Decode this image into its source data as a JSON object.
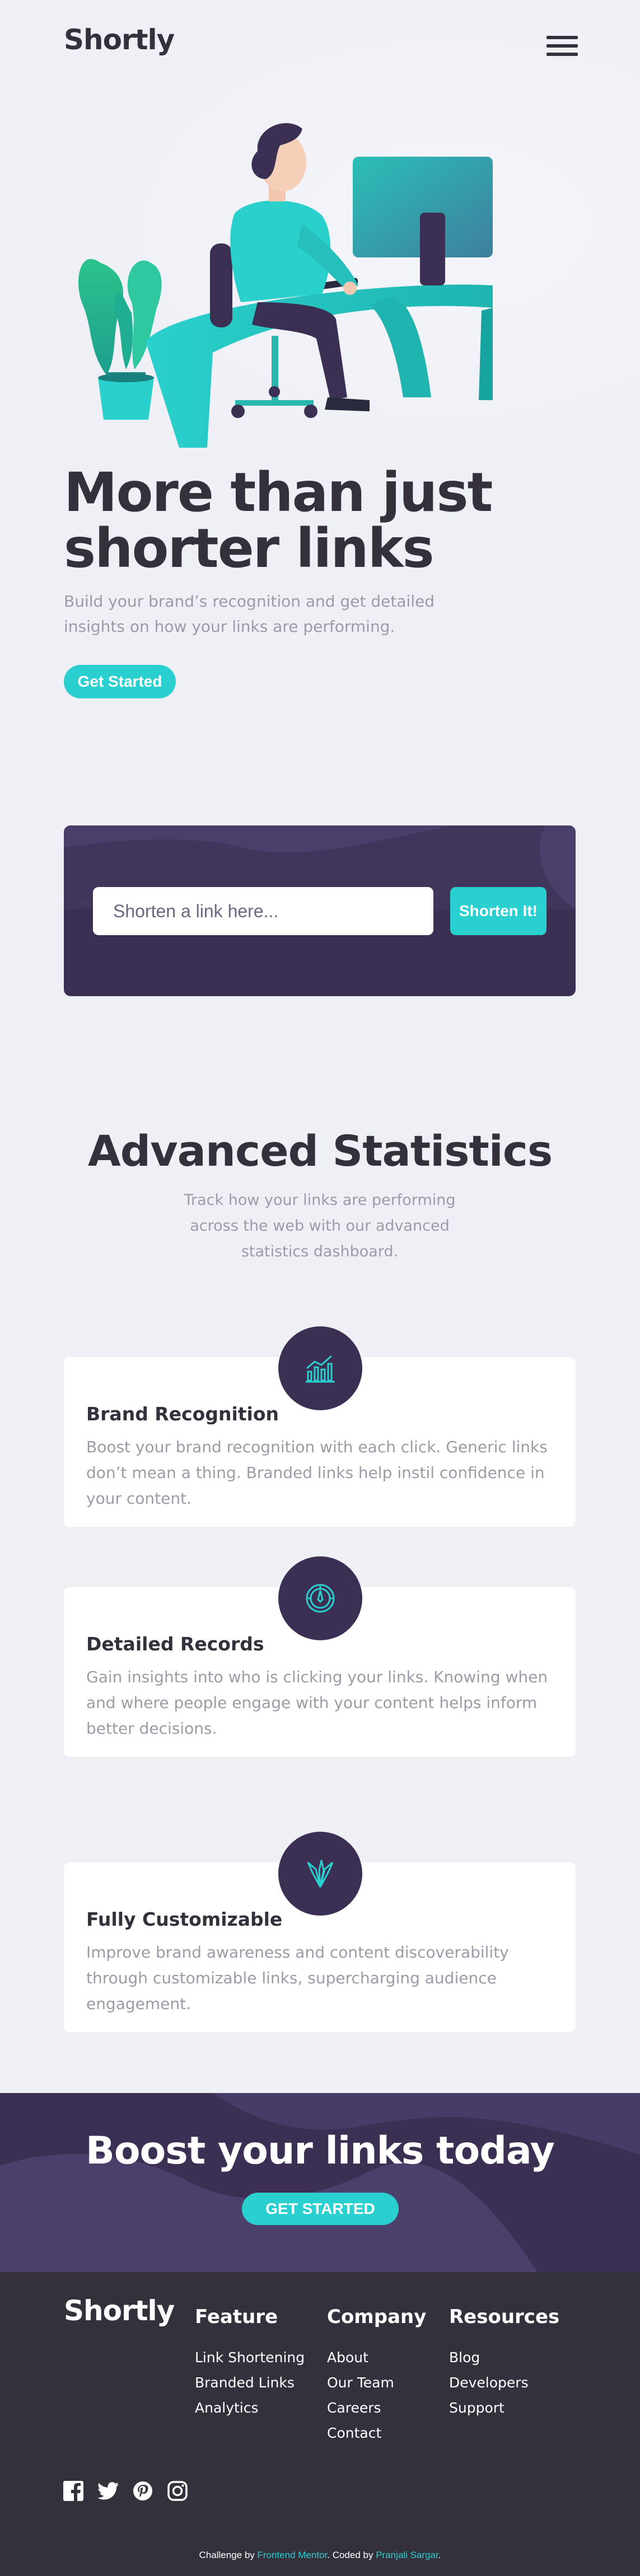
{
  "header": {
    "logo": "Shortly",
    "menu_icon": "hamburger-menu-icon"
  },
  "hero": {
    "title_line1": "More than just",
    "title_line2": "shorter links",
    "subtitle_line1": "Build your brand’s recognition and get detailed",
    "subtitle_line2": "insights on how your links are performing.",
    "cta": "Get Started"
  },
  "shorten": {
    "placeholder": "Shorten a link here...",
    "button": "Shorten It!"
  },
  "stats": {
    "title": "Advanced Statistics",
    "subtitle_line1": "Track how your links are performing",
    "subtitle_line2": "across the web with our advanced",
    "subtitle_line3": "statistics dashboard.",
    "cards": [
      {
        "icon": "brand-recognition-icon",
        "title": "Brand Recognition",
        "lines": [
          "Boost your brand recognition with each click. Generic links",
          "don’t mean a thing. Branded links help instil confidence in",
          "your content."
        ]
      },
      {
        "icon": "detailed-records-icon",
        "title": "Detailed Records",
        "lines": [
          "Gain insights into who is clicking your links. Knowing when",
          "and where people engage with your content helps inform",
          "better decisions."
        ]
      },
      {
        "icon": "fully-customizable-icon",
        "title": "Fully Customizable",
        "lines": [
          "Improve brand awareness and content discoverability",
          "through customizable links, supercharging audience",
          "engagement."
        ]
      }
    ]
  },
  "boost": {
    "title": "Boost your links today",
    "button": "GET STARTED"
  },
  "footer": {
    "logo": "Shortly",
    "columns": [
      {
        "heading": "Feature",
        "links": [
          "Link Shortening",
          "Branded Links",
          "Analytics"
        ]
      },
      {
        "heading": "Company",
        "links": [
          "About",
          "Our Team",
          "Careers",
          "Contact"
        ]
      },
      {
        "heading": "Resources",
        "links": [
          "Blog",
          "Developers",
          "Support"
        ]
      }
    ],
    "social": [
      "facebook-icon",
      "twitter-icon",
      "pinterest-icon",
      "instagram-icon"
    ],
    "attribution": {
      "prefix": "Challenge by ",
      "frontend_mentor": "Frontend Mentor",
      "middle": ". Coded by ",
      "author": "Pranjali Sargar",
      "suffix": "."
    }
  },
  "colors": {
    "cyan": "#2acfcf",
    "dark_violet": "#3b3054",
    "very_dark_violet": "#34313d",
    "gray": "#9e9aa7",
    "background": "#eff0f6"
  }
}
